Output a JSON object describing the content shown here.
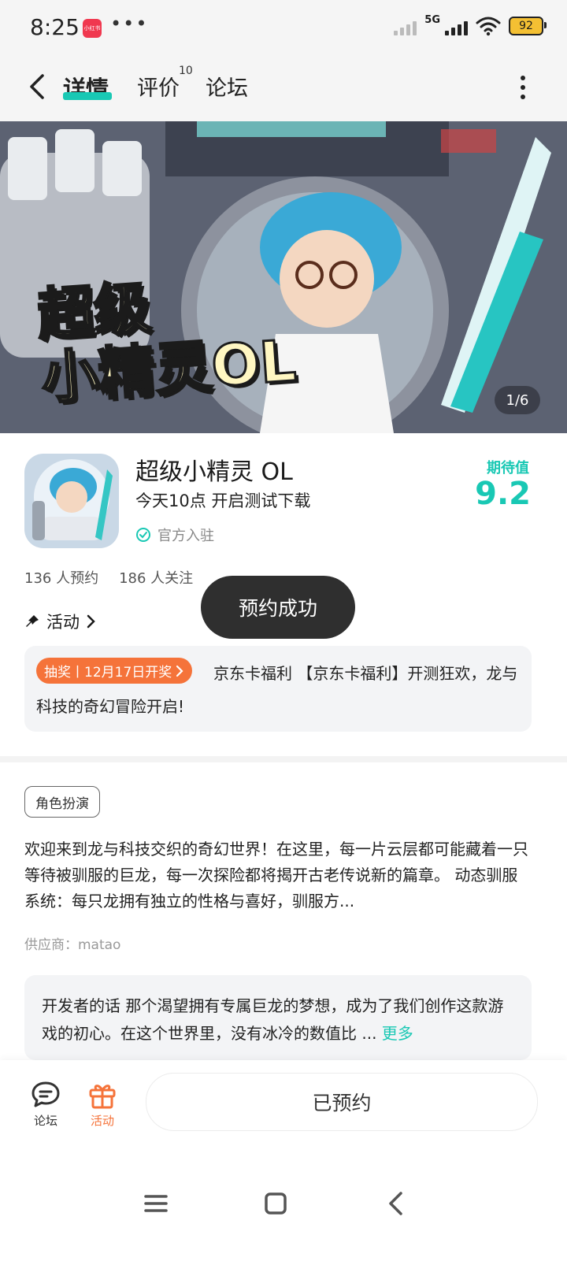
{
  "status_bar": {
    "time": "8:25",
    "app_icon_text": "小红书",
    "network": "5G",
    "battery": "92"
  },
  "header": {
    "tabs": [
      {
        "label": "详情",
        "active": true
      },
      {
        "label": "评价",
        "badge": "10"
      },
      {
        "label": "论坛"
      }
    ]
  },
  "banner": {
    "title_line1": "超级",
    "title_line2": "小精灵OL",
    "pager": "1/6"
  },
  "app": {
    "name": "超级小精灵 OL",
    "subtitle": "今天10点 开启测试下载",
    "official_label": "官方入驻",
    "score_label": "期待值",
    "score": "9.2",
    "reservations": "136 人预约",
    "followers": "186 人关注"
  },
  "activity": {
    "label": "活动",
    "promo_tag": "抽奖丨12月17日开奖",
    "promo_text": "京东卡福利 【京东卡福利】开测狂欢，龙与科技的奇幻冒险开启!"
  },
  "toast": "预约成功",
  "details": {
    "genre": "角色扮演",
    "description": "欢迎来到龙与科技交织的奇幻世界！在这里，每一片云层都可能藏着一只等待被驯服的巨龙，每一次探险都将揭开古老传说新的篇章。 动态驯服系统：每只龙拥有独立的性格与喜好，驯服方...",
    "supplier": "供应商：matao"
  },
  "developer_note": {
    "text": "开发者的话  那个渴望拥有专属巨龙的梦想，成为了我们创作这款游戏的初心。在这个世界里，没有冰冷的数值比 ...",
    "more": "更多"
  },
  "bottom_bar": {
    "forum_label": "论坛",
    "activity_label": "活动",
    "reserved_button": "已预约"
  },
  "colors": {
    "accent": "#19c8b4",
    "orange": "#f5733a",
    "toast_bg": "#2f2f2f"
  }
}
